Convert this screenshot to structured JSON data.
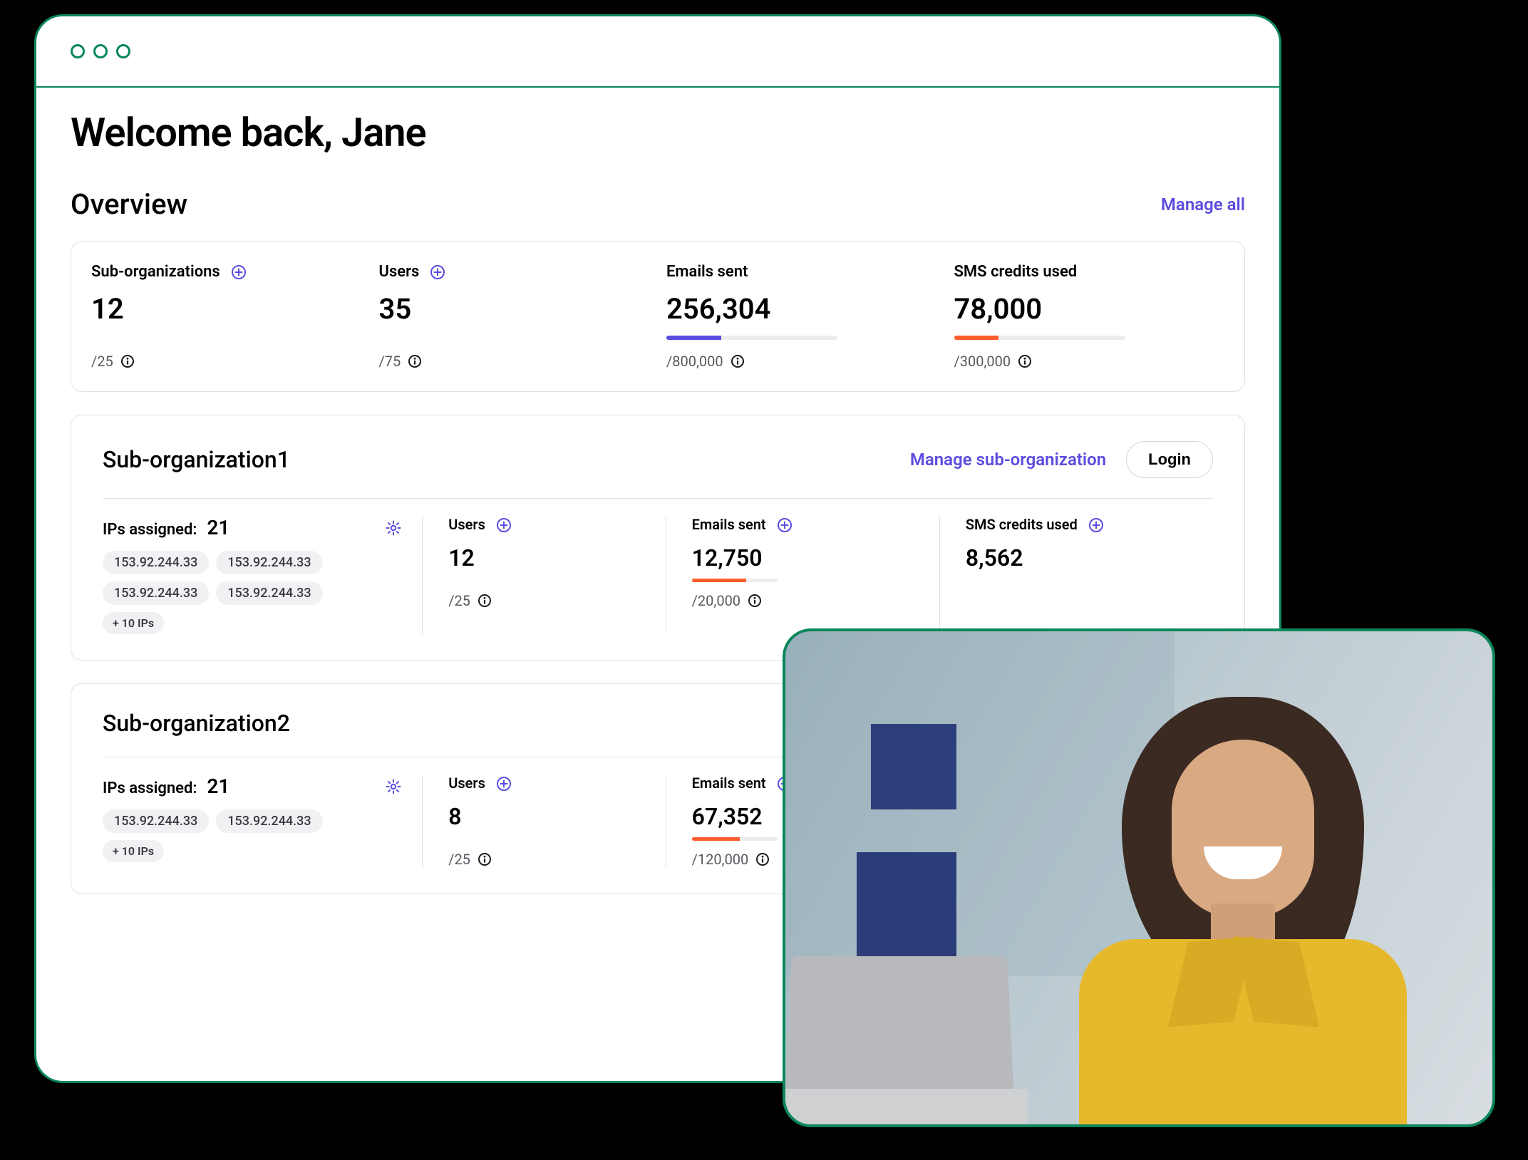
{
  "header": {
    "welcome": "Welcome back, Jane"
  },
  "overview": {
    "title": "Overview",
    "manage_all": "Manage all",
    "metrics": [
      {
        "label": "Sub-organizations",
        "value": "12",
        "limit": "/25",
        "has_add": true,
        "bar": null
      },
      {
        "label": "Users",
        "value": "35",
        "limit": "/75",
        "has_add": true,
        "bar": null
      },
      {
        "label": "Emails sent",
        "value": "256,304",
        "limit": "/800,000",
        "has_add": false,
        "bar": {
          "color": "purple",
          "pct": 32
        }
      },
      {
        "label": "SMS credits used",
        "value": "78,000",
        "limit": "/300,000",
        "has_add": false,
        "bar": {
          "color": "orange",
          "pct": 26
        }
      }
    ]
  },
  "suborgs": [
    {
      "title": "Sub-organization1",
      "manage_label": "Manage sub-organization",
      "login_label": "Login",
      "ips": {
        "label": "IPs assigned:",
        "count": "21",
        "list": [
          "153.92.244.33",
          "153.92.244.33",
          "153.92.244.33",
          "153.92.244.33"
        ],
        "more": "+ 10 IPs"
      },
      "cols": [
        {
          "label": "Users",
          "value": "12",
          "limit": "/25",
          "has_add": true,
          "bar": null
        },
        {
          "label": "Emails sent",
          "value": "12,750",
          "limit": "/20,000",
          "has_add": true,
          "bar": {
            "color": "orange",
            "pct": 64
          }
        },
        {
          "label": "SMS credits used",
          "value": "8,562",
          "limit": "",
          "has_add": true,
          "bar": null
        }
      ]
    },
    {
      "title": "Sub-organization2",
      "manage_label": "",
      "login_label": "",
      "ips": {
        "label": "IPs assigned:",
        "count": "21",
        "list": [
          "153.92.244.33",
          "153.92.244.33"
        ],
        "more": "+ 10 IPs"
      },
      "cols": [
        {
          "label": "Users",
          "value": "8",
          "limit": "/25",
          "has_add": true,
          "bar": null
        },
        {
          "label": "Emails sent",
          "value": "67,352",
          "limit": "/120,000",
          "has_add": true,
          "bar": {
            "color": "orange",
            "pct": 56
          }
        }
      ]
    }
  ],
  "colors": {
    "accent_green": "#0a865a",
    "accent_purple": "#5b4de0",
    "accent_orange": "#ff5c2b"
  }
}
